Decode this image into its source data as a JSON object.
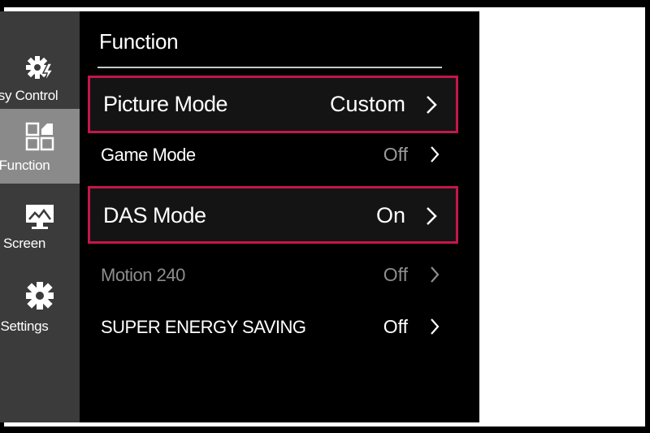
{
  "sidebar": {
    "items": [
      {
        "label": "asy Control",
        "icon": "gear-lightning-icon",
        "active": false
      },
      {
        "label": "Function",
        "icon": "grid-icon",
        "active": true
      },
      {
        "label": "Screen",
        "icon": "monitor-icon",
        "active": false
      },
      {
        "label": "Settings",
        "icon": "gear-icon",
        "active": false
      }
    ]
  },
  "panel": {
    "title": "Function",
    "rows": [
      {
        "label": "Picture Mode",
        "value": "Custom",
        "highlighted": true,
        "dimmed": false
      },
      {
        "label": "Game Mode",
        "value": "Off",
        "highlighted": false,
        "dimmed": false
      },
      {
        "label": "DAS Mode",
        "value": "On",
        "highlighted": true,
        "dimmed": false
      },
      {
        "label": "Motion 240",
        "value": "Off",
        "highlighted": false,
        "dimmed": true
      },
      {
        "label": "SUPER ENERGY SAVING",
        "value": "Off",
        "highlighted": false,
        "dimmed": false
      }
    ]
  },
  "colors": {
    "highlight_border": "#c3174a",
    "sidebar_bg": "#3b3b3b",
    "sidebar_active_bg": "#8a8a8a",
    "panel_bg": "#000000"
  }
}
